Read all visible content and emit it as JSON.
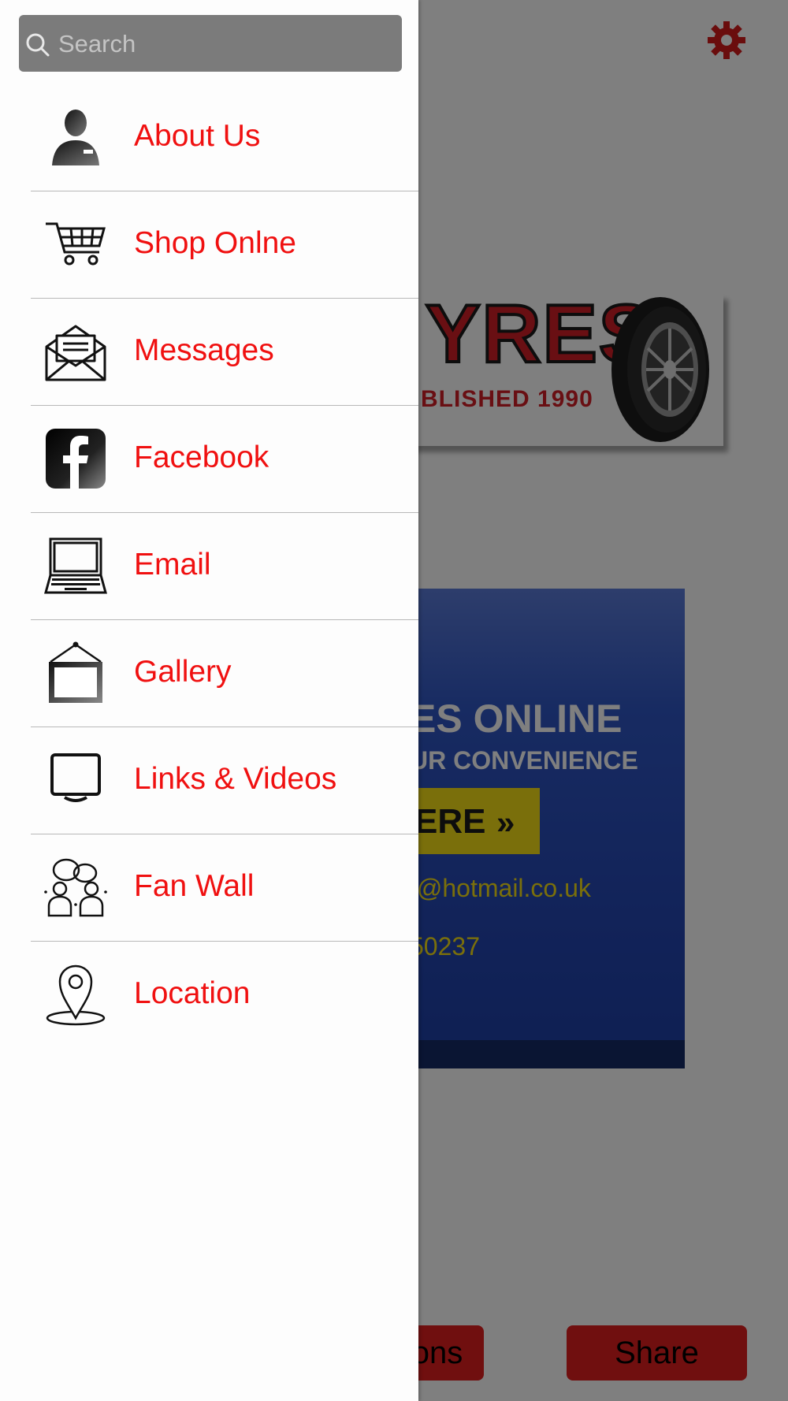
{
  "search": {
    "placeholder": "Search",
    "icon": "search-icon"
  },
  "menu": {
    "items": [
      {
        "label": "About Us",
        "icon": "person-icon"
      },
      {
        "label": "Shop Onlne",
        "icon": "cart-icon"
      },
      {
        "label": "Messages",
        "icon": "envelope-icon"
      },
      {
        "label": "Facebook",
        "icon": "facebook-icon"
      },
      {
        "label": "Email",
        "icon": "laptop-icon"
      },
      {
        "label": "Gallery",
        "icon": "picture-frame-icon"
      },
      {
        "label": "Links & Videos",
        "icon": "monitor-icon"
      },
      {
        "label": "Fan Wall",
        "icon": "people-chat-icon"
      },
      {
        "label": "Location",
        "icon": "map-pin-icon"
      }
    ]
  },
  "background": {
    "settings_icon": "gear-icon",
    "logo": {
      "word": "YRES",
      "subtitle": "BLISHED 1990"
    },
    "promo": {
      "title": "ES ONLINE",
      "subtitle": "UR CONVENIENCE",
      "cta_label": "ERE",
      "cta_icon": "»",
      "email": "t@hotmail.co.uk",
      "phone": "50237"
    },
    "bottom_buttons": {
      "left_label": "ons",
      "share_label": "Share"
    }
  },
  "colors": {
    "accent_red": "#f01010",
    "button_red": "#e01e1e",
    "search_bg": "#7b7b7b",
    "promo_yellow": "#f4de16",
    "promo_blue": "#2446b2"
  }
}
